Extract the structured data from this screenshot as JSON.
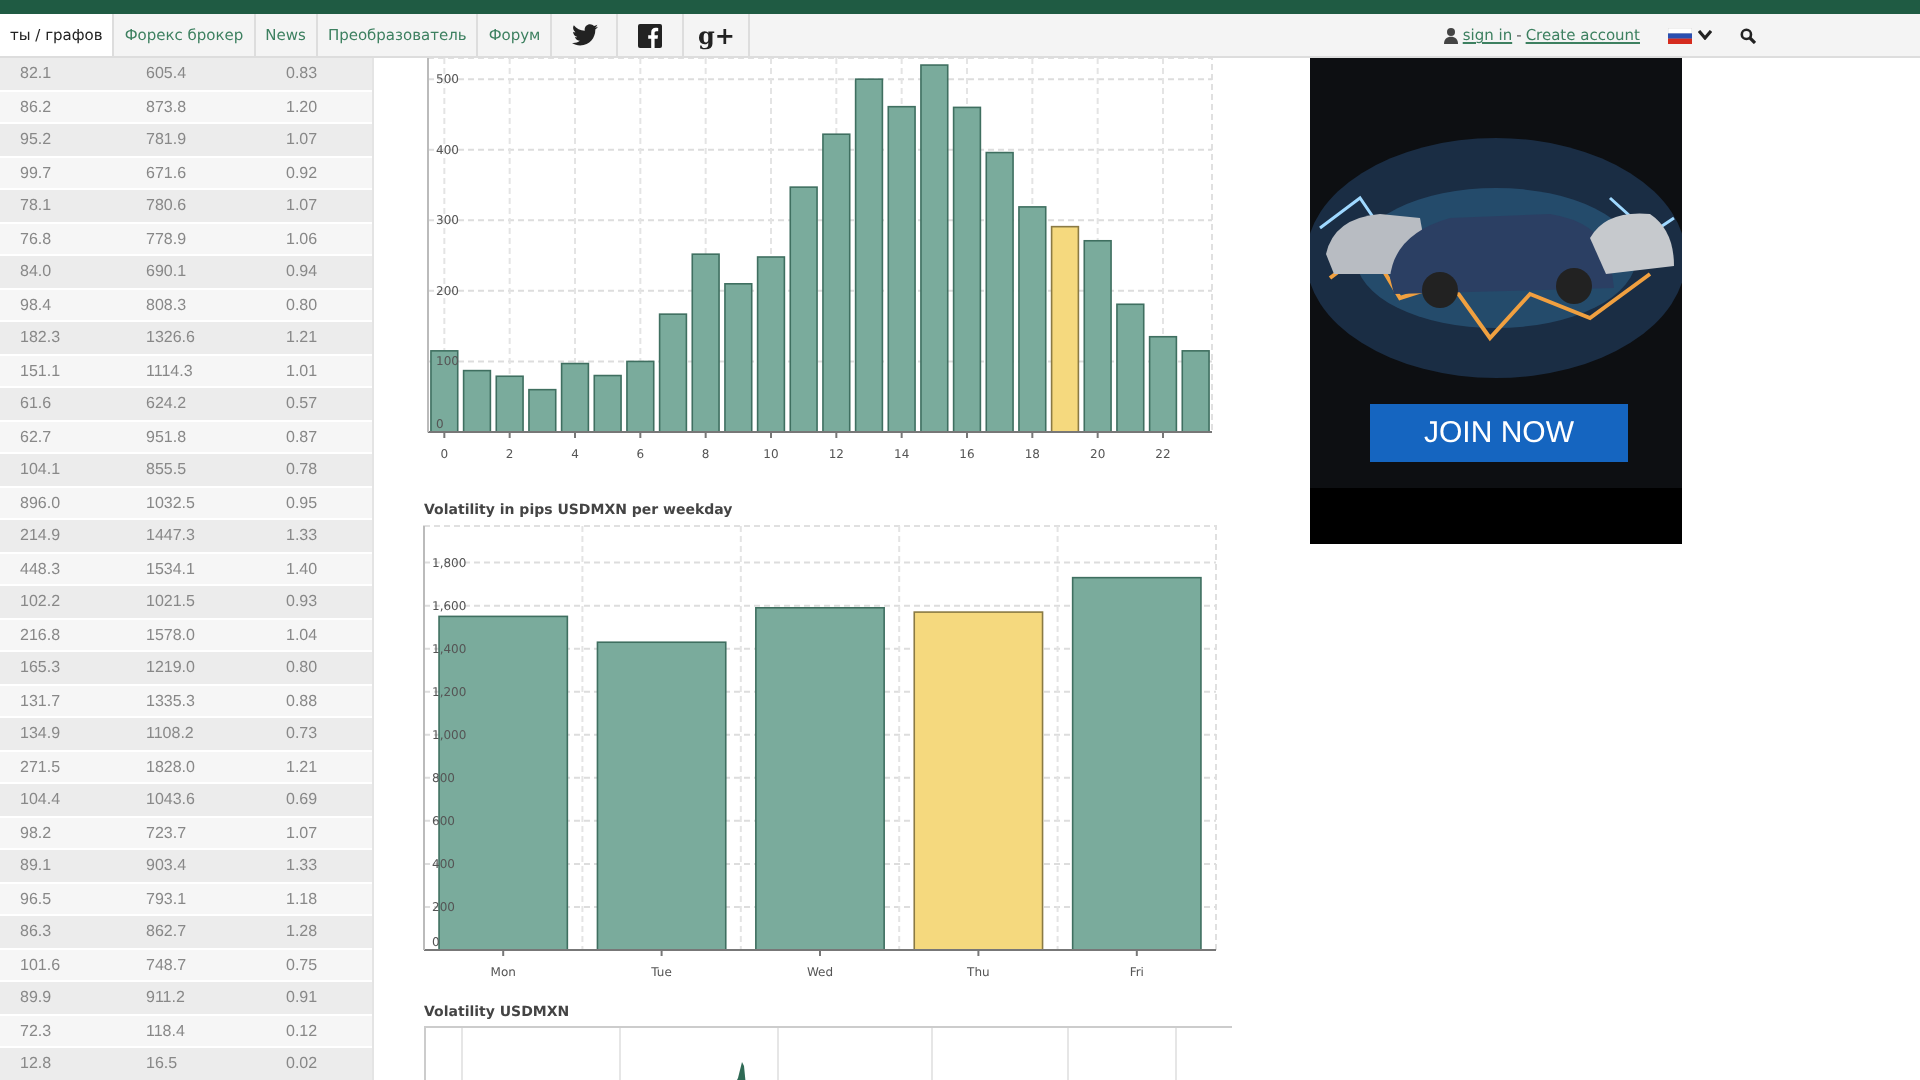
{
  "nav": {
    "tabs": [
      {
        "label": "ты / графов",
        "selected": true
      },
      {
        "label": "Форекс брокер",
        "selected": false
      },
      {
        "label": "News",
        "selected": false
      },
      {
        "label": "Преобразователь",
        "selected": false
      },
      {
        "label": "Форум",
        "selected": false
      }
    ],
    "social": [
      {
        "kind": "twitter"
      },
      {
        "kind": "facebook"
      },
      {
        "kind": "gplus",
        "label": "g+"
      }
    ],
    "account": {
      "sign_in": "sign in",
      "separator": "-",
      "create": "Create account"
    }
  },
  "table": {
    "rows": [
      [
        "82.1",
        "605.4",
        "0.83"
      ],
      [
        "86.2",
        "873.8",
        "1.20"
      ],
      [
        "95.2",
        "781.9",
        "1.07"
      ],
      [
        "99.7",
        "671.6",
        "0.92"
      ],
      [
        "78.1",
        "780.6",
        "1.07"
      ],
      [
        "76.8",
        "778.9",
        "1.06"
      ],
      [
        "84.0",
        "690.1",
        "0.94"
      ],
      [
        "98.4",
        "808.3",
        "0.80"
      ],
      [
        "182.3",
        "1326.6",
        "1.21"
      ],
      [
        "151.1",
        "1114.3",
        "1.01"
      ],
      [
        "61.6",
        "624.2",
        "0.57"
      ],
      [
        "62.7",
        "951.8",
        "0.87"
      ],
      [
        "104.1",
        "855.5",
        "0.78"
      ],
      [
        "896.0",
        "1032.5",
        "0.95"
      ],
      [
        "214.9",
        "1447.3",
        "1.33"
      ],
      [
        "448.3",
        "1534.1",
        "1.40"
      ],
      [
        "102.2",
        "1021.5",
        "0.93"
      ],
      [
        "216.8",
        "1578.0",
        "1.04"
      ],
      [
        "165.3",
        "1219.0",
        "0.80"
      ],
      [
        "131.7",
        "1335.3",
        "0.88"
      ],
      [
        "134.9",
        "1108.2",
        "0.73"
      ],
      [
        "271.5",
        "1828.0",
        "1.21"
      ],
      [
        "104.4",
        "1043.6",
        "0.69"
      ],
      [
        "98.2",
        "723.7",
        "1.07"
      ],
      [
        "89.1",
        "903.4",
        "1.33"
      ],
      [
        "96.5",
        "793.1",
        "1.18"
      ],
      [
        "86.3",
        "862.7",
        "1.28"
      ],
      [
        "101.6",
        "748.7",
        "0.75"
      ],
      [
        "89.9",
        "911.2",
        "0.91"
      ],
      [
        "72.3",
        "118.4",
        "0.12"
      ],
      [
        "12.8",
        "16.5",
        "0.02"
      ]
    ]
  },
  "hourly_chart": {
    "chart_data": {
      "type": "bar",
      "x": [
        0,
        1,
        2,
        3,
        4,
        5,
        6,
        7,
        8,
        9,
        10,
        11,
        12,
        13,
        14,
        15,
        16,
        17,
        18,
        19,
        20,
        21,
        22,
        23
      ],
      "series": [
        {
          "color": "#7aab9c",
          "values": [
            115,
            87,
            79,
            60,
            97,
            80,
            100,
            167,
            252,
            210,
            248,
            347,
            422,
            500,
            461,
            520,
            460,
            396,
            319,
            null,
            271,
            181,
            135,
            115
          ]
        },
        {
          "color": "#f5d97e",
          "values": [
            null,
            null,
            null,
            null,
            null,
            null,
            null,
            null,
            null,
            null,
            null,
            null,
            null,
            null,
            null,
            null,
            null,
            null,
            null,
            291,
            null,
            null,
            null,
            null
          ]
        }
      ],
      "grid": true,
      "xlim": [
        -0.5,
        23.5
      ],
      "ylim": [
        0,
        530
      ],
      "yticks": [
        0,
        100,
        200,
        300,
        400,
        500
      ],
      "xticks": [
        0,
        2,
        4,
        6,
        8,
        10,
        12,
        14,
        16,
        18,
        20,
        22
      ]
    }
  },
  "weekday_chart": {
    "title": "Volatility in pips USDMXN per weekday",
    "chart_data": {
      "type": "bar",
      "categories": [
        "Mon",
        "Tue",
        "Wed",
        "Thu",
        "Fri"
      ],
      "series": [
        {
          "color": "#7aab9c",
          "values": [
            1550,
            1430,
            1590,
            null,
            1730
          ]
        },
        {
          "color": "#f5d97e",
          "values": [
            null,
            null,
            null,
            1570,
            null
          ]
        }
      ],
      "grid": true,
      "ylim": [
        0,
        1970
      ],
      "yticks": [
        0,
        {
          "value": 200,
          "label": "200"
        },
        {
          "value": 400,
          "label": "400"
        },
        {
          "value": 600,
          "label": "600"
        },
        {
          "value": 800,
          "label": "800"
        },
        {
          "value": 1000,
          "label": "1,000"
        },
        {
          "value": 1200,
          "label": "1,200"
        },
        {
          "value": 1400,
          "label": "1,400"
        },
        {
          "value": 1600,
          "label": "1,600"
        },
        {
          "value": 1800,
          "label": "1,800"
        }
      ]
    }
  },
  "volatility_chart": {
    "title": "Volatility USDMXN"
  },
  "ad": {
    "kind": "picture",
    "button": "JOIN NOW"
  }
}
